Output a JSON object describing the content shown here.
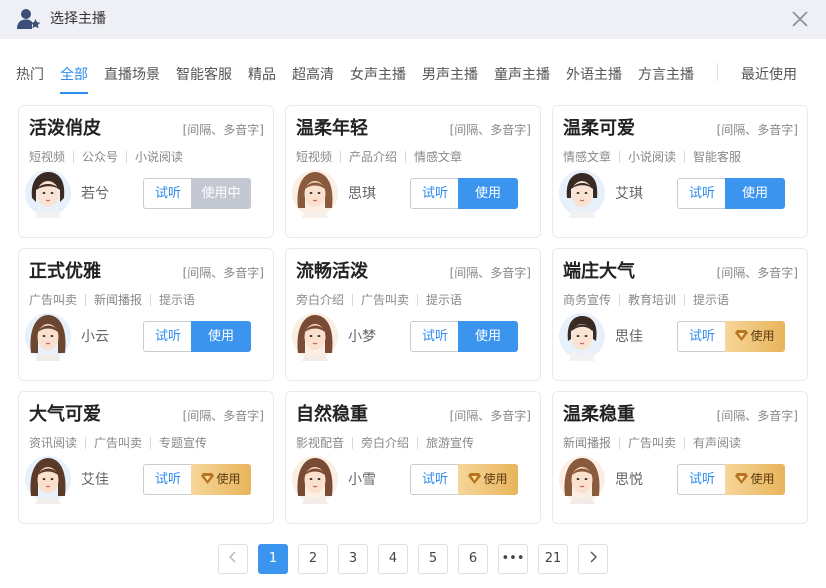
{
  "dialog": {
    "title": "选择主播"
  },
  "tabs": [
    "热门",
    "全部",
    "直播场景",
    "智能客服",
    "精品",
    "超高清",
    "女声主播",
    "男声主播",
    "童声主播",
    "外语主播",
    "方言主播",
    "最近使用"
  ],
  "active_tab": "全部",
  "cards": [
    {
      "title": "活泼俏皮",
      "note": "[间隔、多音字]",
      "tags": [
        "短视频",
        "公众号",
        "小说阅读"
      ],
      "voice": "若兮",
      "listen": "试听",
      "use": "使用中",
      "use_state": "in-use"
    },
    {
      "title": "温柔年轻",
      "note": "[间隔、多音字]",
      "tags": [
        "短视频",
        "产品介绍",
        "情感文章"
      ],
      "voice": "思琪",
      "listen": "试听",
      "use": "使用",
      "use_state": "primary"
    },
    {
      "title": "温柔可爱",
      "note": "[间隔、多音字]",
      "tags": [
        "情感文章",
        "小说阅读",
        "智能客服"
      ],
      "voice": "艾琪",
      "listen": "试听",
      "use": "使用",
      "use_state": "primary"
    },
    {
      "title": "正式优雅",
      "note": "[间隔、多音字]",
      "tags": [
        "广告叫卖",
        "新闻播报",
        "提示语"
      ],
      "voice": "小云",
      "listen": "试听",
      "use": "使用",
      "use_state": "primary"
    },
    {
      "title": "流畅活泼",
      "note": "[间隔、多音字]",
      "tags": [
        "旁白介绍",
        "广告叫卖",
        "提示语"
      ],
      "voice": "小梦",
      "listen": "试听",
      "use": "使用",
      "use_state": "primary"
    },
    {
      "title": "端庄大气",
      "note": "[间隔、多音字]",
      "tags": [
        "商务宣传",
        "教育培训",
        "提示语"
      ],
      "voice": "思佳",
      "listen": "试听",
      "use": "使用",
      "use_state": "vip"
    },
    {
      "title": "大气可爱",
      "note": "[间隔、多音字]",
      "tags": [
        "资讯阅读",
        "广告叫卖",
        "专题宣传"
      ],
      "voice": "艾佳",
      "listen": "试听",
      "use": "使用",
      "use_state": "vip"
    },
    {
      "title": "自然稳重",
      "note": "[间隔、多音字]",
      "tags": [
        "影视配音",
        "旁白介绍",
        "旅游宣传"
      ],
      "voice": "小雪",
      "listen": "试听",
      "use": "使用",
      "use_state": "vip"
    },
    {
      "title": "温柔稳重",
      "note": "[间隔、多音字]",
      "tags": [
        "新闻播报",
        "广告叫卖",
        "有声阅读"
      ],
      "voice": "思悦",
      "listen": "试听",
      "use": "使用",
      "use_state": "vip"
    }
  ],
  "pagination": {
    "pages": [
      "1",
      "2",
      "3",
      "4",
      "5",
      "6",
      "•••",
      "21"
    ],
    "current": "1"
  },
  "colors": {
    "accent": "#2d8cf0",
    "use_button": "#3b95ef",
    "in_use_button": "#c4c8d2",
    "vip_gold": "#e8b45b",
    "titlebar_bg": "#eef0f5"
  },
  "icons": {
    "title": "user-star-icon",
    "close": "close-icon",
    "vip": "diamond-icon",
    "prev": "chevron-left-icon",
    "next": "chevron-right-icon"
  }
}
